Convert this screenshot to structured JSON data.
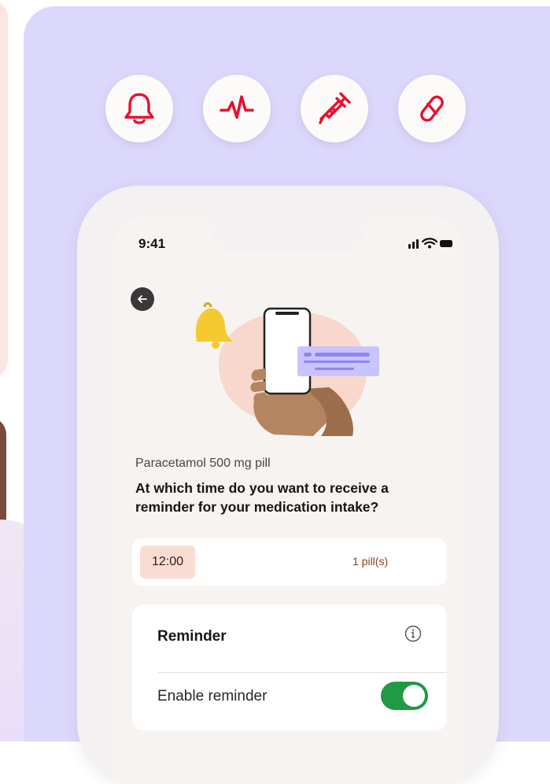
{
  "status_bar": {
    "time": "9:41"
  },
  "feature_icons": [
    {
      "name": "bell-icon"
    },
    {
      "name": "heartbeat-icon"
    },
    {
      "name": "syringe-icon"
    },
    {
      "name": "pill-icon"
    }
  ],
  "medication": {
    "name": "Paracetamol 500 mg pill",
    "question": "At which time do you want to receive a reminder for your medication intake?"
  },
  "schedule": {
    "time": "12:00",
    "dose": "1 pill(s)"
  },
  "reminder": {
    "title": "Reminder",
    "enable_label": "Enable reminder",
    "enabled": true
  },
  "colors": {
    "accent_red": "#e8102f",
    "background_lavender": "#dcd8fb",
    "toggle_green": "#1f9a45",
    "time_chip": "#fbdcd3",
    "dose_text": "#8a3d1d"
  }
}
